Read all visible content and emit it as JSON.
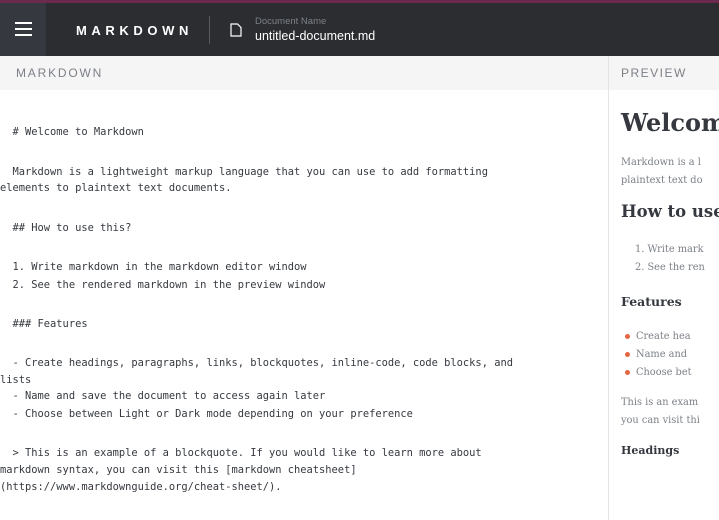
{
  "header": {
    "brand": "MARKDOWN",
    "doc_caption": "Document Name",
    "doc_name": "untitled-document.md"
  },
  "panes": {
    "editor_label": "MARKDOWN",
    "preview_label": "PREVIEW"
  },
  "editor": {
    "lines": [
      "  # Welcome to Markdown",
      "  Markdown is a lightweight markup language that you can use to add formatting",
      "elements to plaintext text documents.",
      "  ## How to use this?",
      "  1. Write markdown in the markdown editor window",
      "  2. See the rendered markdown in the preview window",
      "  ### Features",
      "  - Create headings, paragraphs, links, blockquotes, inline-code, code blocks, and",
      "lists",
      "  - Name and save the document to access again later",
      "  - Choose between Light or Dark mode depending on your preference",
      "  > This is an example of a blockquote. If you would like to learn more about",
      "markdown syntax, you can visit this [markdown cheatsheet]",
      "(https://www.markdownguide.org/cheat-sheet/)."
    ]
  },
  "preview": {
    "h1": "Welcom",
    "intro": [
      "Markdown is a l",
      "plaintext text do"
    ],
    "h2": "How to use",
    "ordered": [
      "1. Write mark",
      "2. See the ren"
    ],
    "h3": "Features",
    "bullets": [
      "Create hea",
      "Name and",
      "Choose bet"
    ],
    "quote": [
      "This is an exam",
      "you can visit thi"
    ],
    "h4": "Headings"
  },
  "colors": {
    "header_bg": "#2b2d31",
    "accent": "#e46643",
    "text_muted": "#7c8187"
  }
}
